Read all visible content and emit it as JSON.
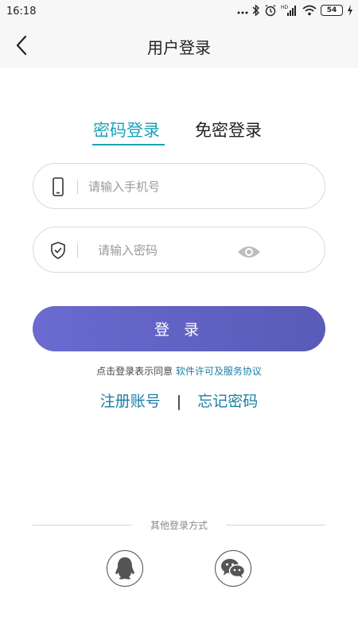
{
  "status_bar": {
    "time": "16:18",
    "battery": "54",
    "icons": [
      "more-dots-icon",
      "bluetooth-icon",
      "alarm-icon",
      "hd-signal-icon",
      "wifi-icon",
      "battery-icon",
      "charging-icon"
    ]
  },
  "header": {
    "title": "用户登录",
    "back_icon": "chevron-left-icon"
  },
  "tabs": [
    {
      "label": "密码登录",
      "active": true
    },
    {
      "label": "免密登录",
      "active": false
    }
  ],
  "form": {
    "phone": {
      "placeholder": "请输入手机号",
      "value": "",
      "icon": "phone-icon"
    },
    "password": {
      "placeholder": "请输入密码",
      "value": "",
      "icon": "shield-check-icon",
      "toggle_icon": "eye-icon"
    },
    "login_label": "登 录"
  },
  "agreement": {
    "prefix": "点击登录表示同意",
    "link": "软件许可及服务协议"
  },
  "links": {
    "register": "注册账号",
    "separator": "|",
    "forgot": "忘记密码"
  },
  "other_login": {
    "label": "其他登录方式",
    "methods": [
      {
        "icon": "qq-icon"
      },
      {
        "icon": "wechat-icon"
      }
    ]
  },
  "colors": {
    "accent": "#1aa3b8",
    "link": "#1a7fa8",
    "button_start": "#6a6ad0",
    "button_end": "#5a5ab8"
  }
}
